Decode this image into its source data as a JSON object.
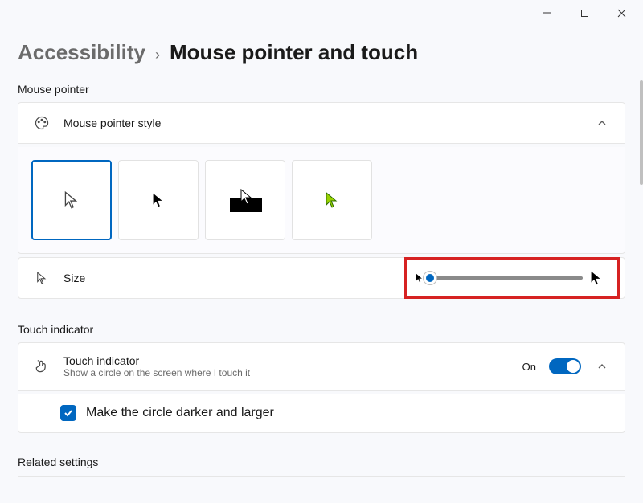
{
  "window": {
    "minimize": "–",
    "maximize": "□",
    "close": "✕"
  },
  "breadcrumb": {
    "parent": "Accessibility",
    "separator": "›",
    "page": "Mouse pointer and touch"
  },
  "mouse_pointer": {
    "section_label": "Mouse pointer",
    "style_row_label": "Mouse pointer style",
    "styles": [
      {
        "name": "white-outline",
        "selected": true
      },
      {
        "name": "black-solid",
        "selected": false
      },
      {
        "name": "inverted",
        "selected": false
      },
      {
        "name": "custom-color",
        "selected": false,
        "accent": "#99d200"
      }
    ],
    "size_label": "Size",
    "size_value_percent": 0
  },
  "touch": {
    "section_label": "Touch indicator",
    "row_title": "Touch indicator",
    "row_subtitle": "Show a circle on the screen where I touch it",
    "toggle_state_label": "On",
    "toggle_on": true,
    "checkbox_checked": true,
    "checkbox_label": "Make the circle darker and larger"
  },
  "related": {
    "section_label": "Related settings"
  }
}
